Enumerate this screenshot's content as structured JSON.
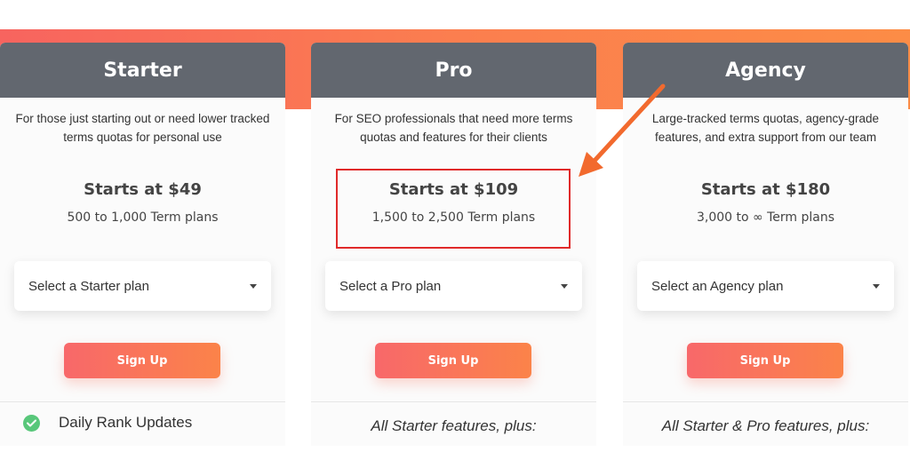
{
  "plans": [
    {
      "id": "starter",
      "title": "Starter",
      "description": "For those just starting out or need lower tracked terms quotas for personal use",
      "price": "Starts at $49",
      "range": "500 to 1,000 Term plans",
      "select_value": "Select a Starter plan",
      "signup_label": "Sign Up",
      "feature": {
        "icon": "check-circle-icon",
        "label": "Daily Rank Updates"
      }
    },
    {
      "id": "pro",
      "title": "Pro",
      "description": "For SEO professionals that need more terms quotas and features for their clients",
      "price": "Starts at $109",
      "range": "1,500 to 2,500 Term plans",
      "select_value": "Select a Pro plan",
      "signup_label": "Sign Up",
      "features_intro": "All Starter features, plus:"
    },
    {
      "id": "agency",
      "title": "Agency",
      "description": "Large-tracked terms quotas, agency-grade features, and extra support from our team",
      "price": "Starts at $180",
      "range": "3,000 to ∞ Term plans",
      "select_value": "Select an Agency plan",
      "signup_label": "Sign Up",
      "features_intro": "All Starter & Pro features, plus:"
    }
  ],
  "annotation": {
    "color": "#e02a2a",
    "arrow_color": "#f26a2e",
    "target": "pro price"
  },
  "colors": {
    "header_bg": "#62676f",
    "banner_gradient": [
      "#f7645f",
      "#fc8c46"
    ],
    "button_gradient": [
      "#f8686a",
      "#fb8349"
    ],
    "check": "#58c77a"
  }
}
